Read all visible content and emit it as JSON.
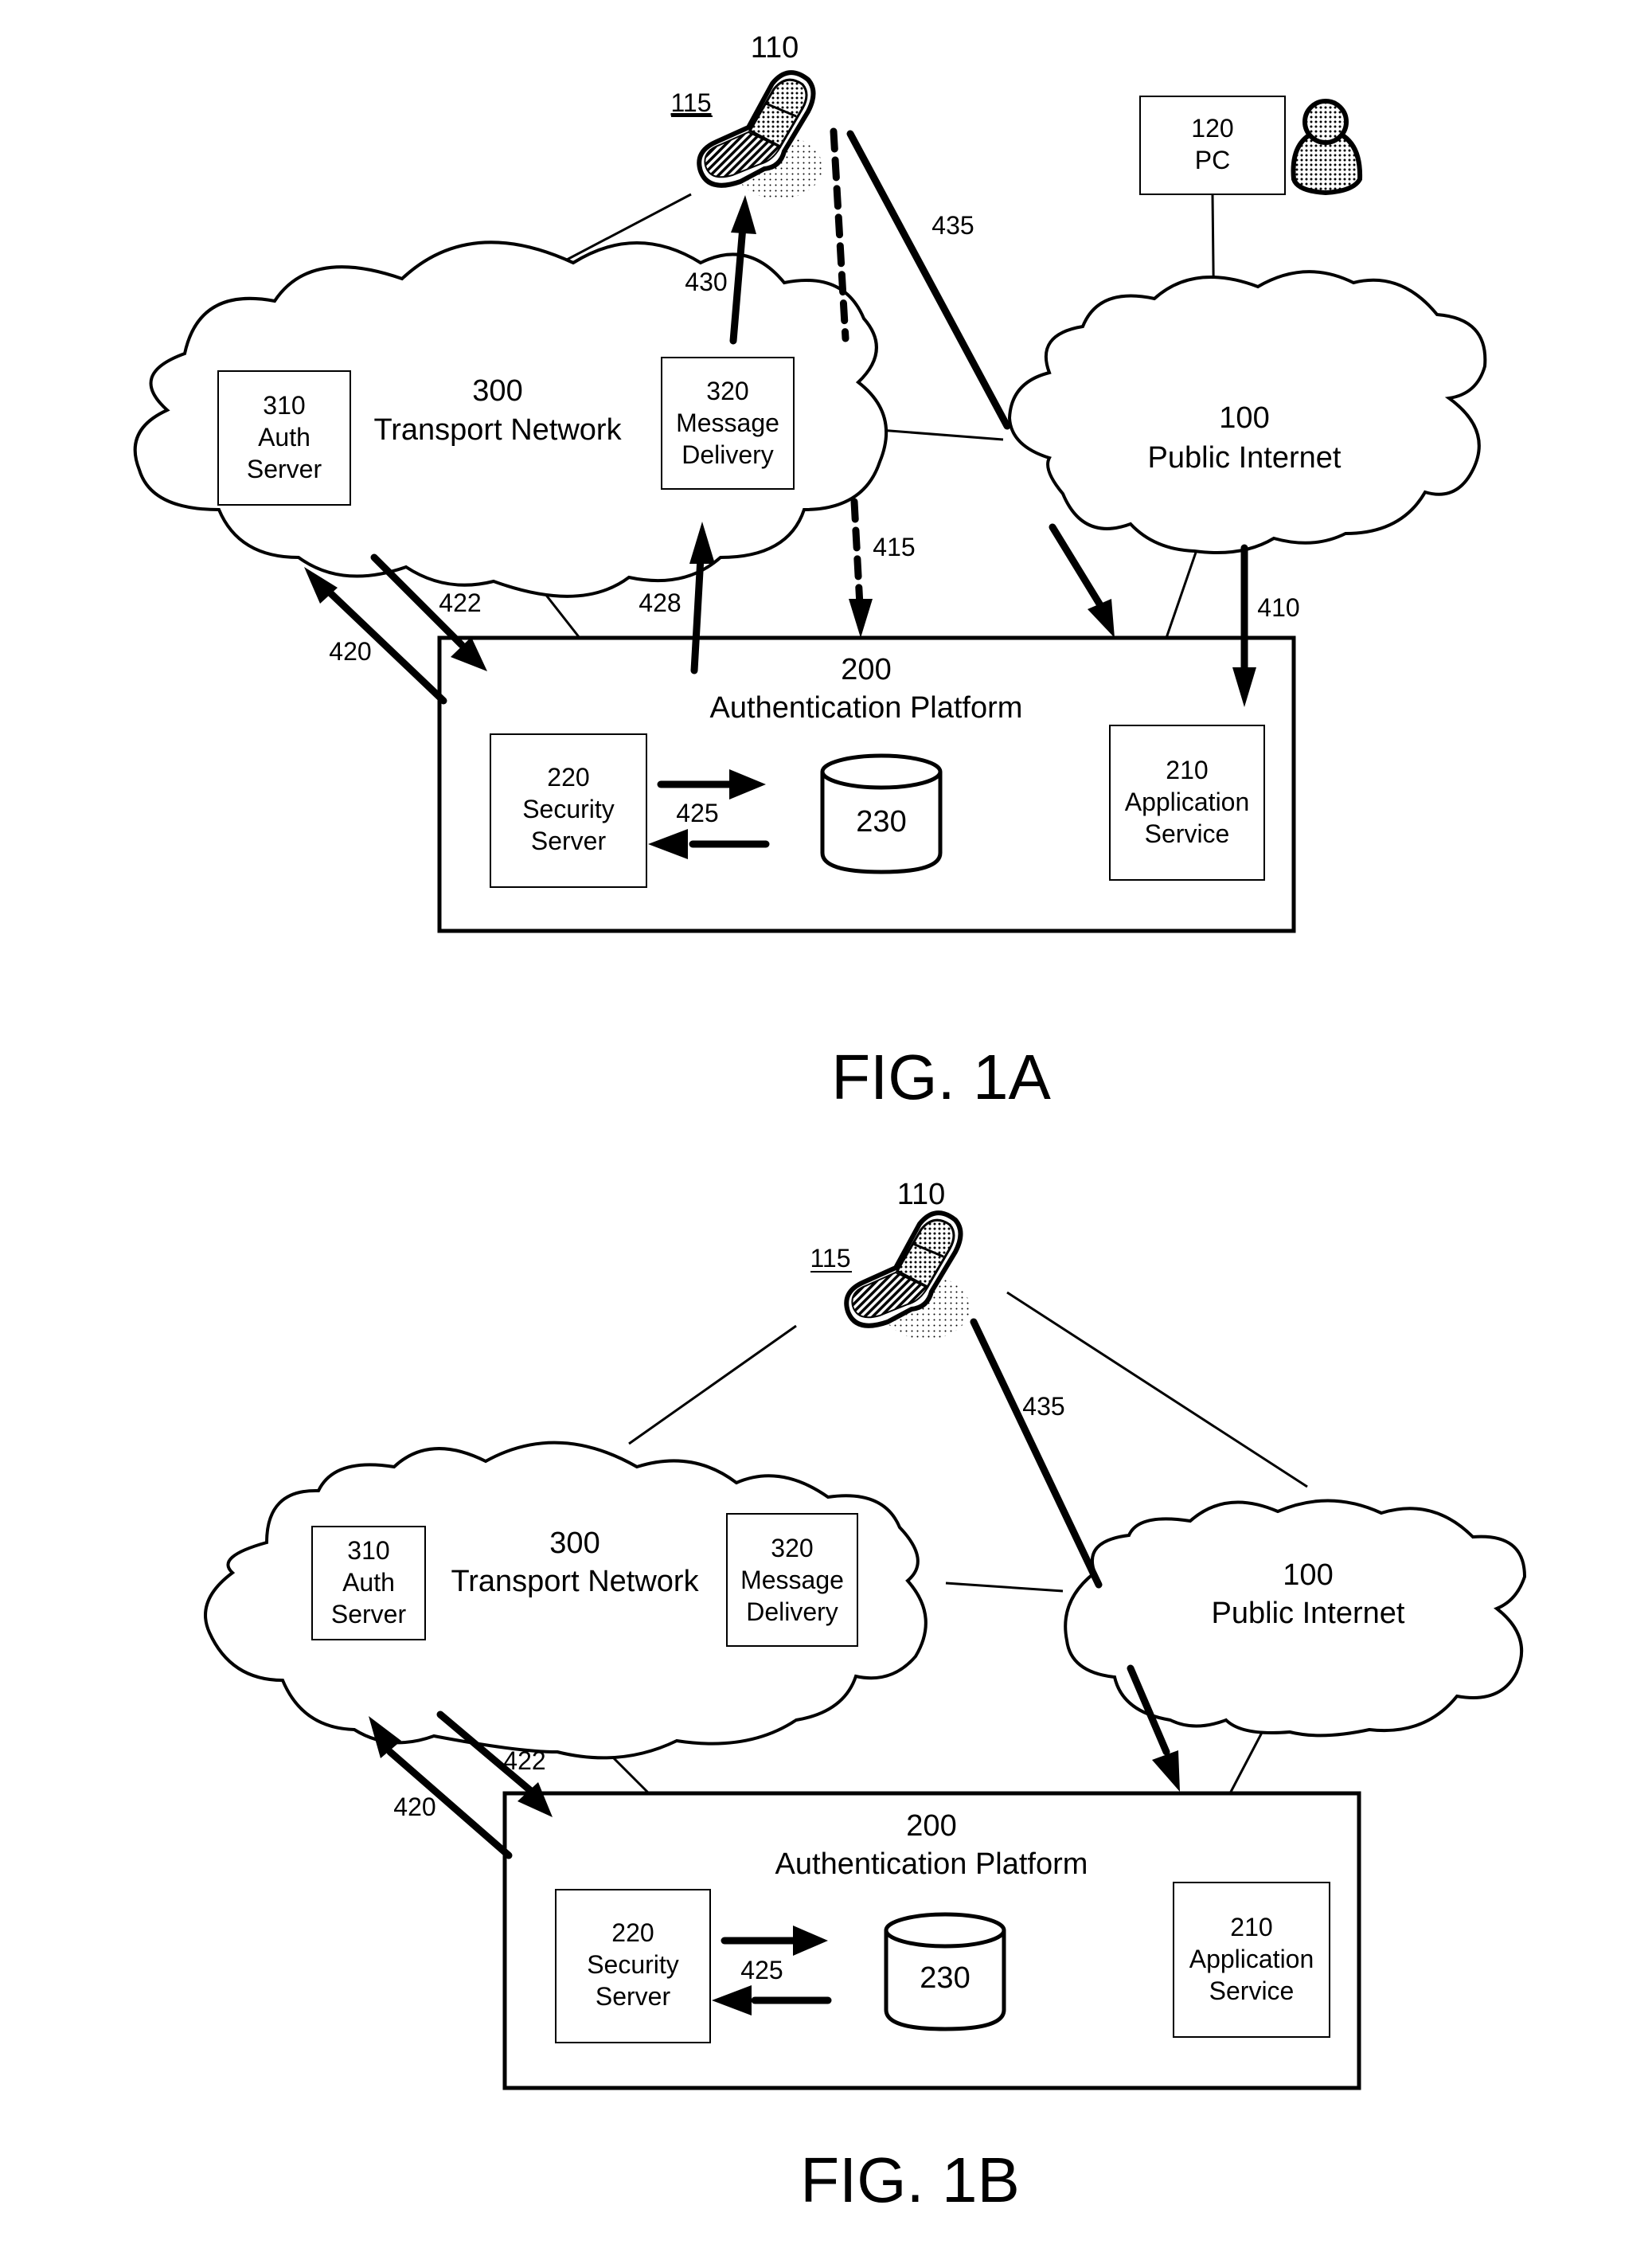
{
  "figures": [
    {
      "id": "fig1a",
      "caption": "FIG. 1A",
      "device": {
        "ref": "110",
        "sub_ref": "115",
        "icon": "mobile-phone-icon"
      },
      "pc": {
        "ref": "120",
        "label": "PC",
        "user_icon": "person-icon"
      },
      "transport_network": {
        "ref": "300",
        "label": "Transport Network"
      },
      "auth_server": {
        "ref": "310",
        "line1": "Auth",
        "line2": "Server"
      },
      "message_delivery": {
        "ref": "320",
        "line1": "Message",
        "line2": "Delivery"
      },
      "public_internet": {
        "ref": "100",
        "label": "Public Internet"
      },
      "platform": {
        "ref": "200",
        "label": "Authentication Platform"
      },
      "security_server": {
        "ref": "220",
        "line1": "Security",
        "line2": "Server"
      },
      "database": {
        "ref": "230"
      },
      "application_service": {
        "ref": "210",
        "line1": "Application",
        "line2": "Service"
      },
      "flows": {
        "f410": "410",
        "f415": "415",
        "f420": "420",
        "f422": "422",
        "f425": "425",
        "f428": "428",
        "f430": "430",
        "f435": "435"
      }
    },
    {
      "id": "fig1b",
      "caption": "FIG. 1B",
      "device": {
        "ref": "110",
        "sub_ref": "115",
        "icon": "mobile-phone-icon"
      },
      "transport_network": {
        "ref": "300",
        "label": "Transport Network"
      },
      "auth_server": {
        "ref": "310",
        "line1": "Auth",
        "line2": "Server"
      },
      "message_delivery": {
        "ref": "320",
        "line1": "Message",
        "line2": "Delivery"
      },
      "public_internet": {
        "ref": "100",
        "label": "Public Internet"
      },
      "platform": {
        "ref": "200",
        "label": "Authentication Platform"
      },
      "security_server": {
        "ref": "220",
        "line1": "Security",
        "line2": "Server"
      },
      "database": {
        "ref": "230"
      },
      "application_service": {
        "ref": "210",
        "line1": "Application",
        "line2": "Service"
      },
      "flows": {
        "f420": "420",
        "f422": "422",
        "f425": "425",
        "f435": "435"
      }
    }
  ]
}
